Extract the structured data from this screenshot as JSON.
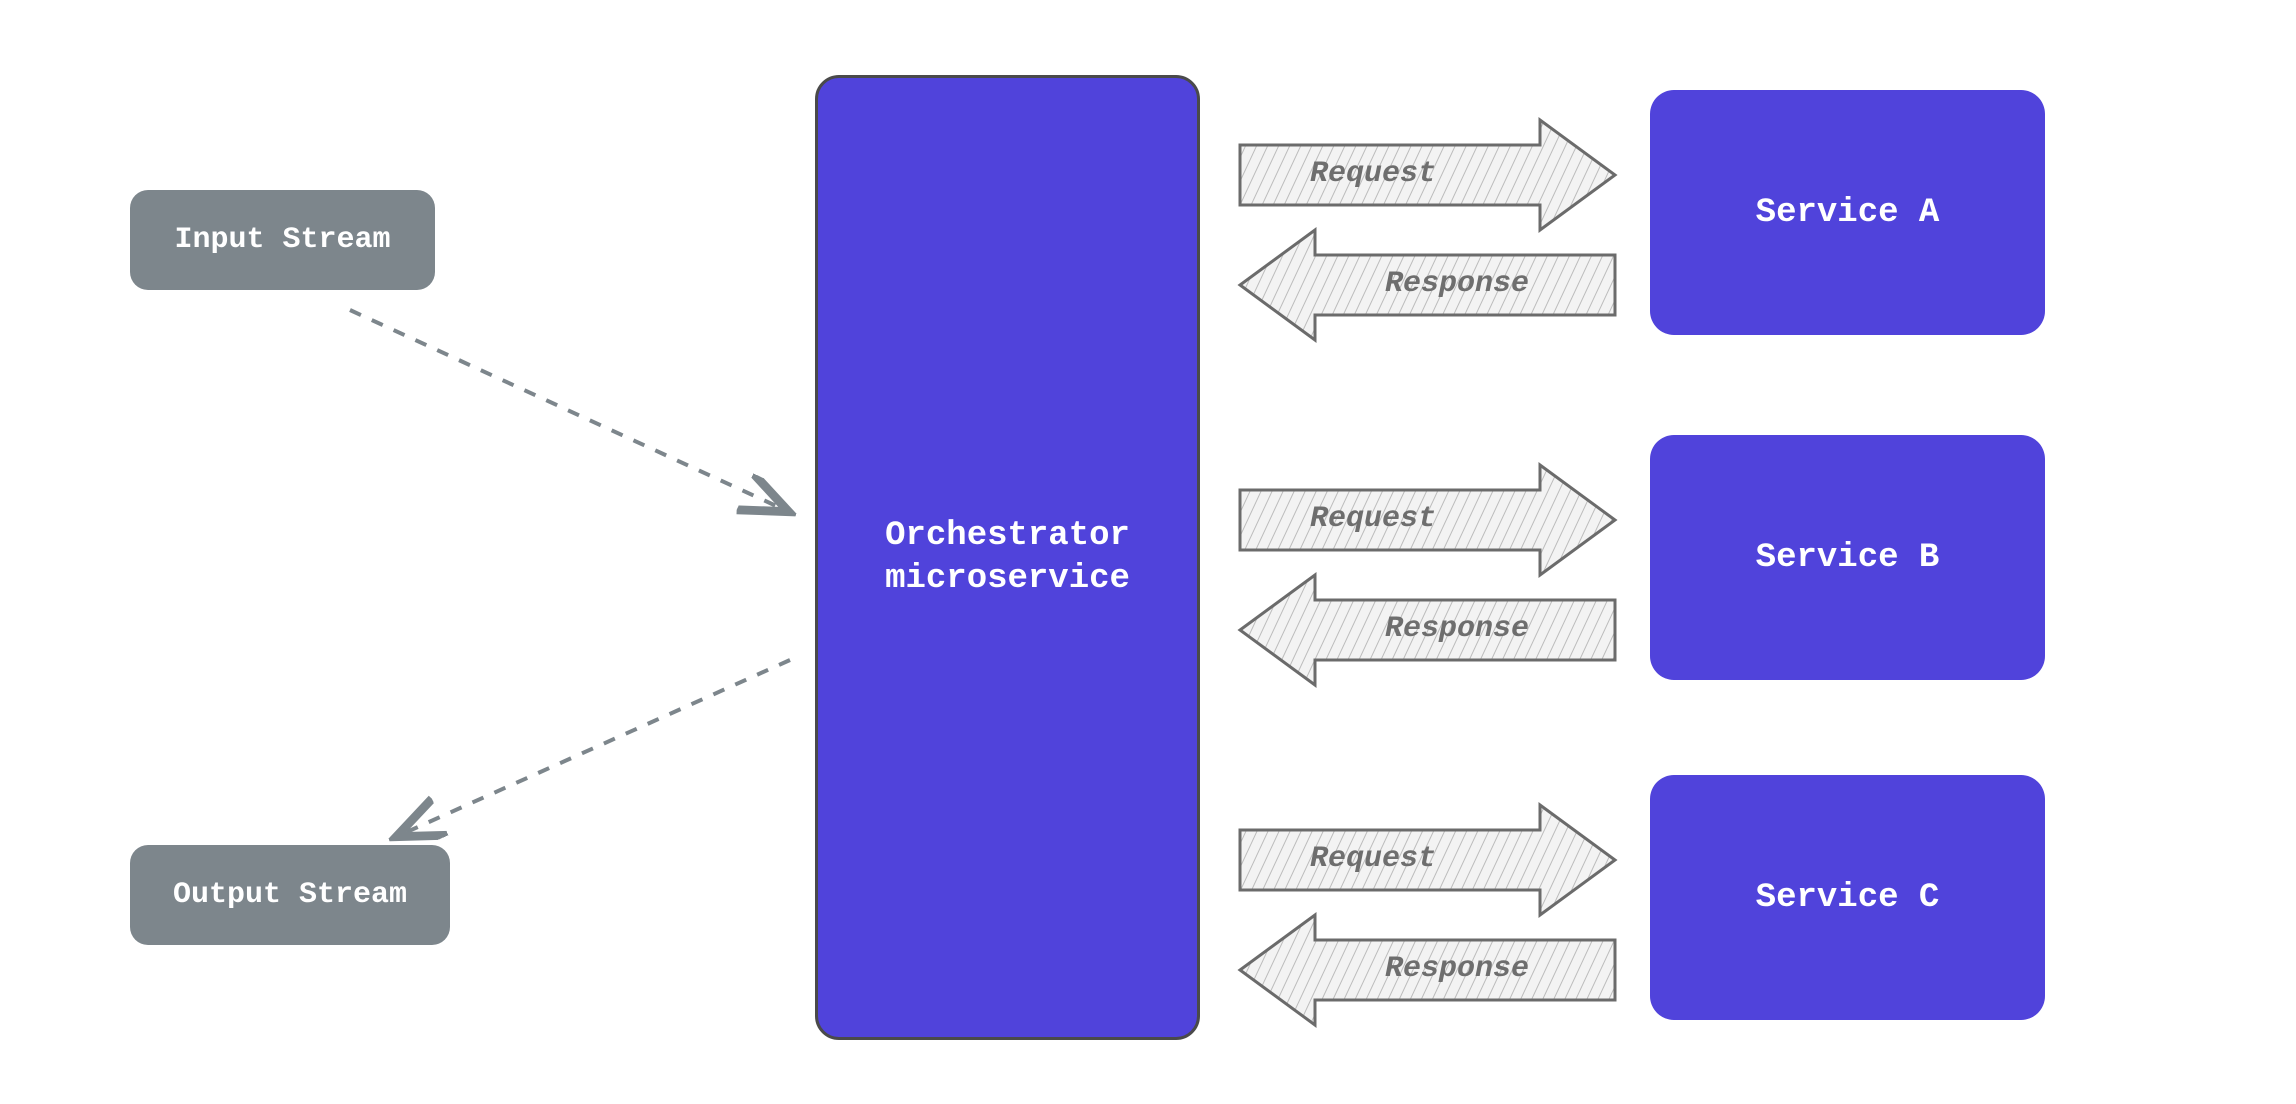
{
  "colors": {
    "gray_node": "#7d868c",
    "blue_node": "#5043db",
    "white_text": "#ffffff",
    "arrow_label": "#6e6e6e",
    "dashed_line": "#7d868c",
    "arrow_stroke": "#6b6b6b",
    "arrow_fill_hatch": "#d6d6d6"
  },
  "nodes": {
    "input_stream": {
      "label": "Input Stream"
    },
    "output_stream": {
      "label": "Output Stream"
    },
    "orchestrator": {
      "line1": "Orchestrator",
      "line2": "microservice"
    },
    "service_a": {
      "label": "Service A"
    },
    "service_b": {
      "label": "Service B"
    },
    "service_c": {
      "label": "Service C"
    }
  },
  "arrows": {
    "to_service_a": {
      "request": {
        "label": "Request",
        "direction": "right"
      },
      "response": {
        "label": "Response",
        "direction": "left"
      }
    },
    "to_service_b": {
      "request": {
        "label": "Request",
        "direction": "right"
      },
      "response": {
        "label": "Response",
        "direction": "left"
      }
    },
    "to_service_c": {
      "request": {
        "label": "Request",
        "direction": "right"
      },
      "response": {
        "label": "Response",
        "direction": "left"
      }
    }
  },
  "connections": {
    "input_to_orchestrator": {
      "style": "dashed",
      "direction": "right_down"
    },
    "orchestrator_to_output": {
      "style": "dashed",
      "direction": "left_down"
    }
  }
}
